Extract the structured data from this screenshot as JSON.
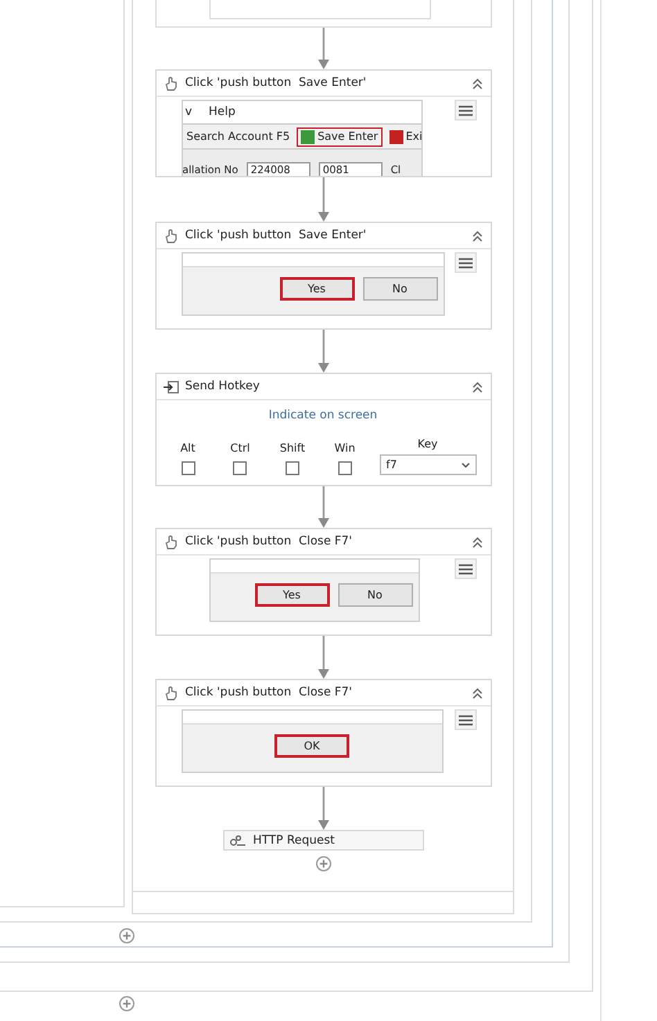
{
  "activities": [
    {
      "kind": "click",
      "title": "Click 'push button  Save Enter'",
      "preview": {
        "kind": "app_window",
        "menu": [
          "v",
          "Help"
        ],
        "toolbar": [
          {
            "label": "Search Account F5",
            "highlighted": false
          },
          {
            "label": "Save Enter",
            "highlighted": true,
            "color": "#3c9a3c"
          },
          {
            "label": "Exi",
            "highlighted": false,
            "color": "#c42222"
          }
        ],
        "fields": [
          {
            "kind": "label",
            "text": "allation No"
          },
          {
            "kind": "field",
            "text": "224008"
          },
          {
            "kind": "field",
            "text": "0081"
          },
          {
            "kind": "label",
            "text": "Cl"
          }
        ]
      }
    },
    {
      "kind": "click",
      "title": "Click 'push button  Save Enter'",
      "preview": {
        "kind": "dialog",
        "buttons": [
          {
            "label": "Yes",
            "highlighted": true
          },
          {
            "label": "No",
            "highlighted": false
          }
        ]
      }
    },
    {
      "kind": "hotkey",
      "title": "Send Hotkey",
      "link": "Indicate on screen",
      "modifiers": [
        {
          "label": "Alt",
          "checked": false
        },
        {
          "label": "Ctrl",
          "checked": false
        },
        {
          "label": "Shift",
          "checked": false
        },
        {
          "label": "Win",
          "checked": false
        }
      ],
      "key_label": "Key",
      "key_value": "f7"
    },
    {
      "kind": "click",
      "title": "Click 'push button  Close F7'",
      "preview": {
        "kind": "dialog",
        "buttons": [
          {
            "label": "Yes",
            "highlighted": true
          },
          {
            "label": "No",
            "highlighted": false
          }
        ]
      }
    },
    {
      "kind": "click",
      "title": "Click 'push button  Close F7'",
      "preview": {
        "kind": "dialog",
        "buttons": [
          {
            "label": "OK",
            "highlighted": true
          }
        ]
      }
    }
  ],
  "final_activity": {
    "title": "HTTP Request"
  }
}
